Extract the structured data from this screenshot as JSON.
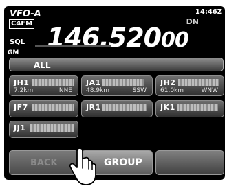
{
  "header": {
    "vfo": "VFO-A",
    "mode": "C4FM",
    "time": "14:46Z",
    "dn": "DN",
    "sql": "SQL",
    "gm": "GM"
  },
  "frequency": {
    "main": "146.520",
    "sub": "00"
  },
  "filter": {
    "label": "ALL"
  },
  "stations": [
    {
      "call": "JH1",
      "distance": "7.2km",
      "direction": "NNE"
    },
    {
      "call": "JA1",
      "distance": "48.9km",
      "direction": "SSW"
    },
    {
      "call": "JH2",
      "distance": "61.0km",
      "direction": "WNW"
    },
    {
      "call": "JF7",
      "distance": "",
      "direction": ""
    },
    {
      "call": "JR1",
      "distance": "",
      "direction": ""
    },
    {
      "call": "JK1",
      "distance": "",
      "direction": ""
    },
    {
      "call": "JJ1",
      "distance": "",
      "direction": ""
    }
  ],
  "buttons": {
    "back": "BACK",
    "group": "GROUP"
  },
  "icons": {
    "touch": "pointing-hand-icon"
  }
}
